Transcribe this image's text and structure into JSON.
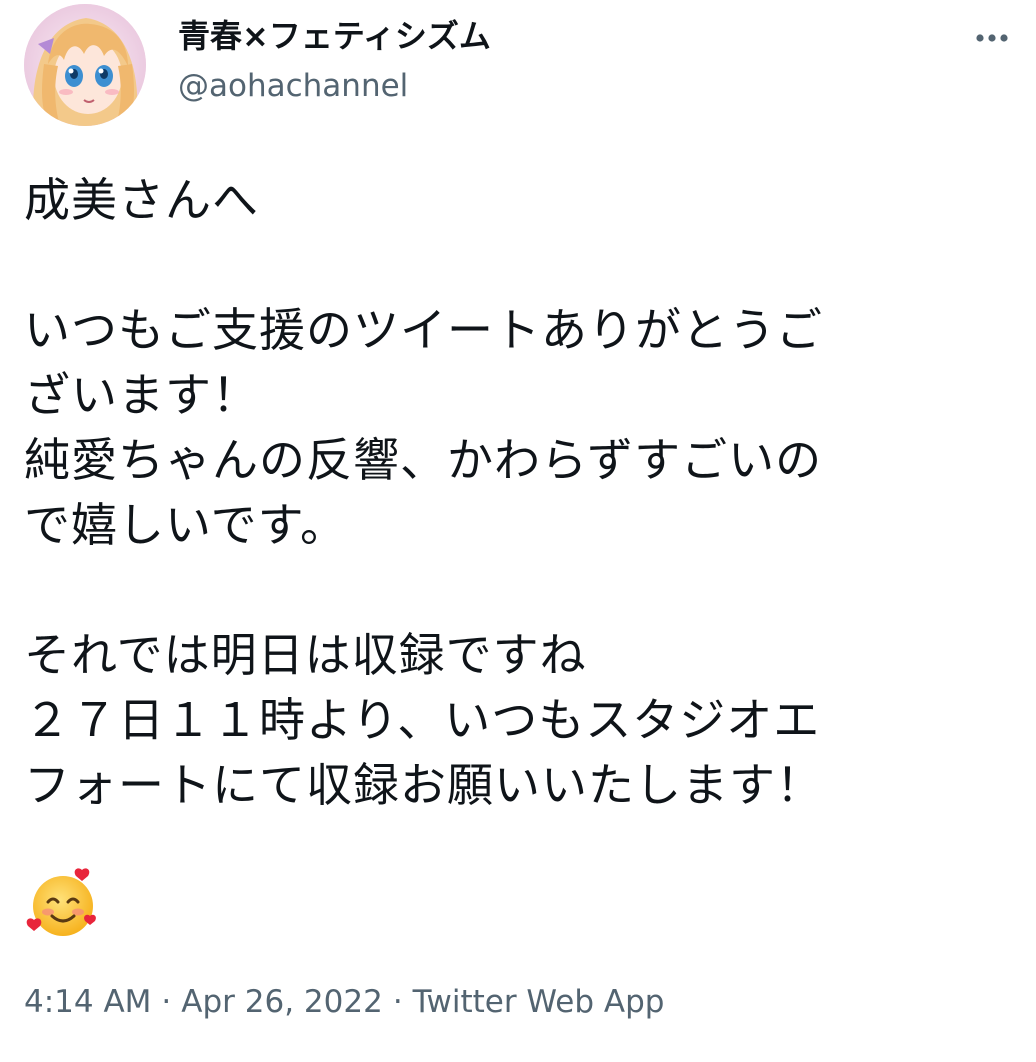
{
  "author": {
    "display_name": "青春×フェティシズム",
    "handle": "@aohachannel",
    "avatar_icon": "avatar-anime-girl"
  },
  "more_icon": "more-dots-icon",
  "tweet": {
    "lines": [
      "成美さんへ",
      "",
      "いつもご支援のツイートありがとうご",
      "ざいます！",
      "純愛ちゃんの反響、かわらずすごいの",
      "で嬉しいです。",
      "",
      "それでは明日は収録ですね",
      "２７日１１時より、いつもスタジオエ",
      "フォートにて収録お願いいたします！"
    ],
    "emoji": "smiling-face-with-hearts"
  },
  "meta": {
    "time": "4:14 AM",
    "separator": "·",
    "date": "Apr 26, 2022",
    "source": "Twitter Web App"
  }
}
